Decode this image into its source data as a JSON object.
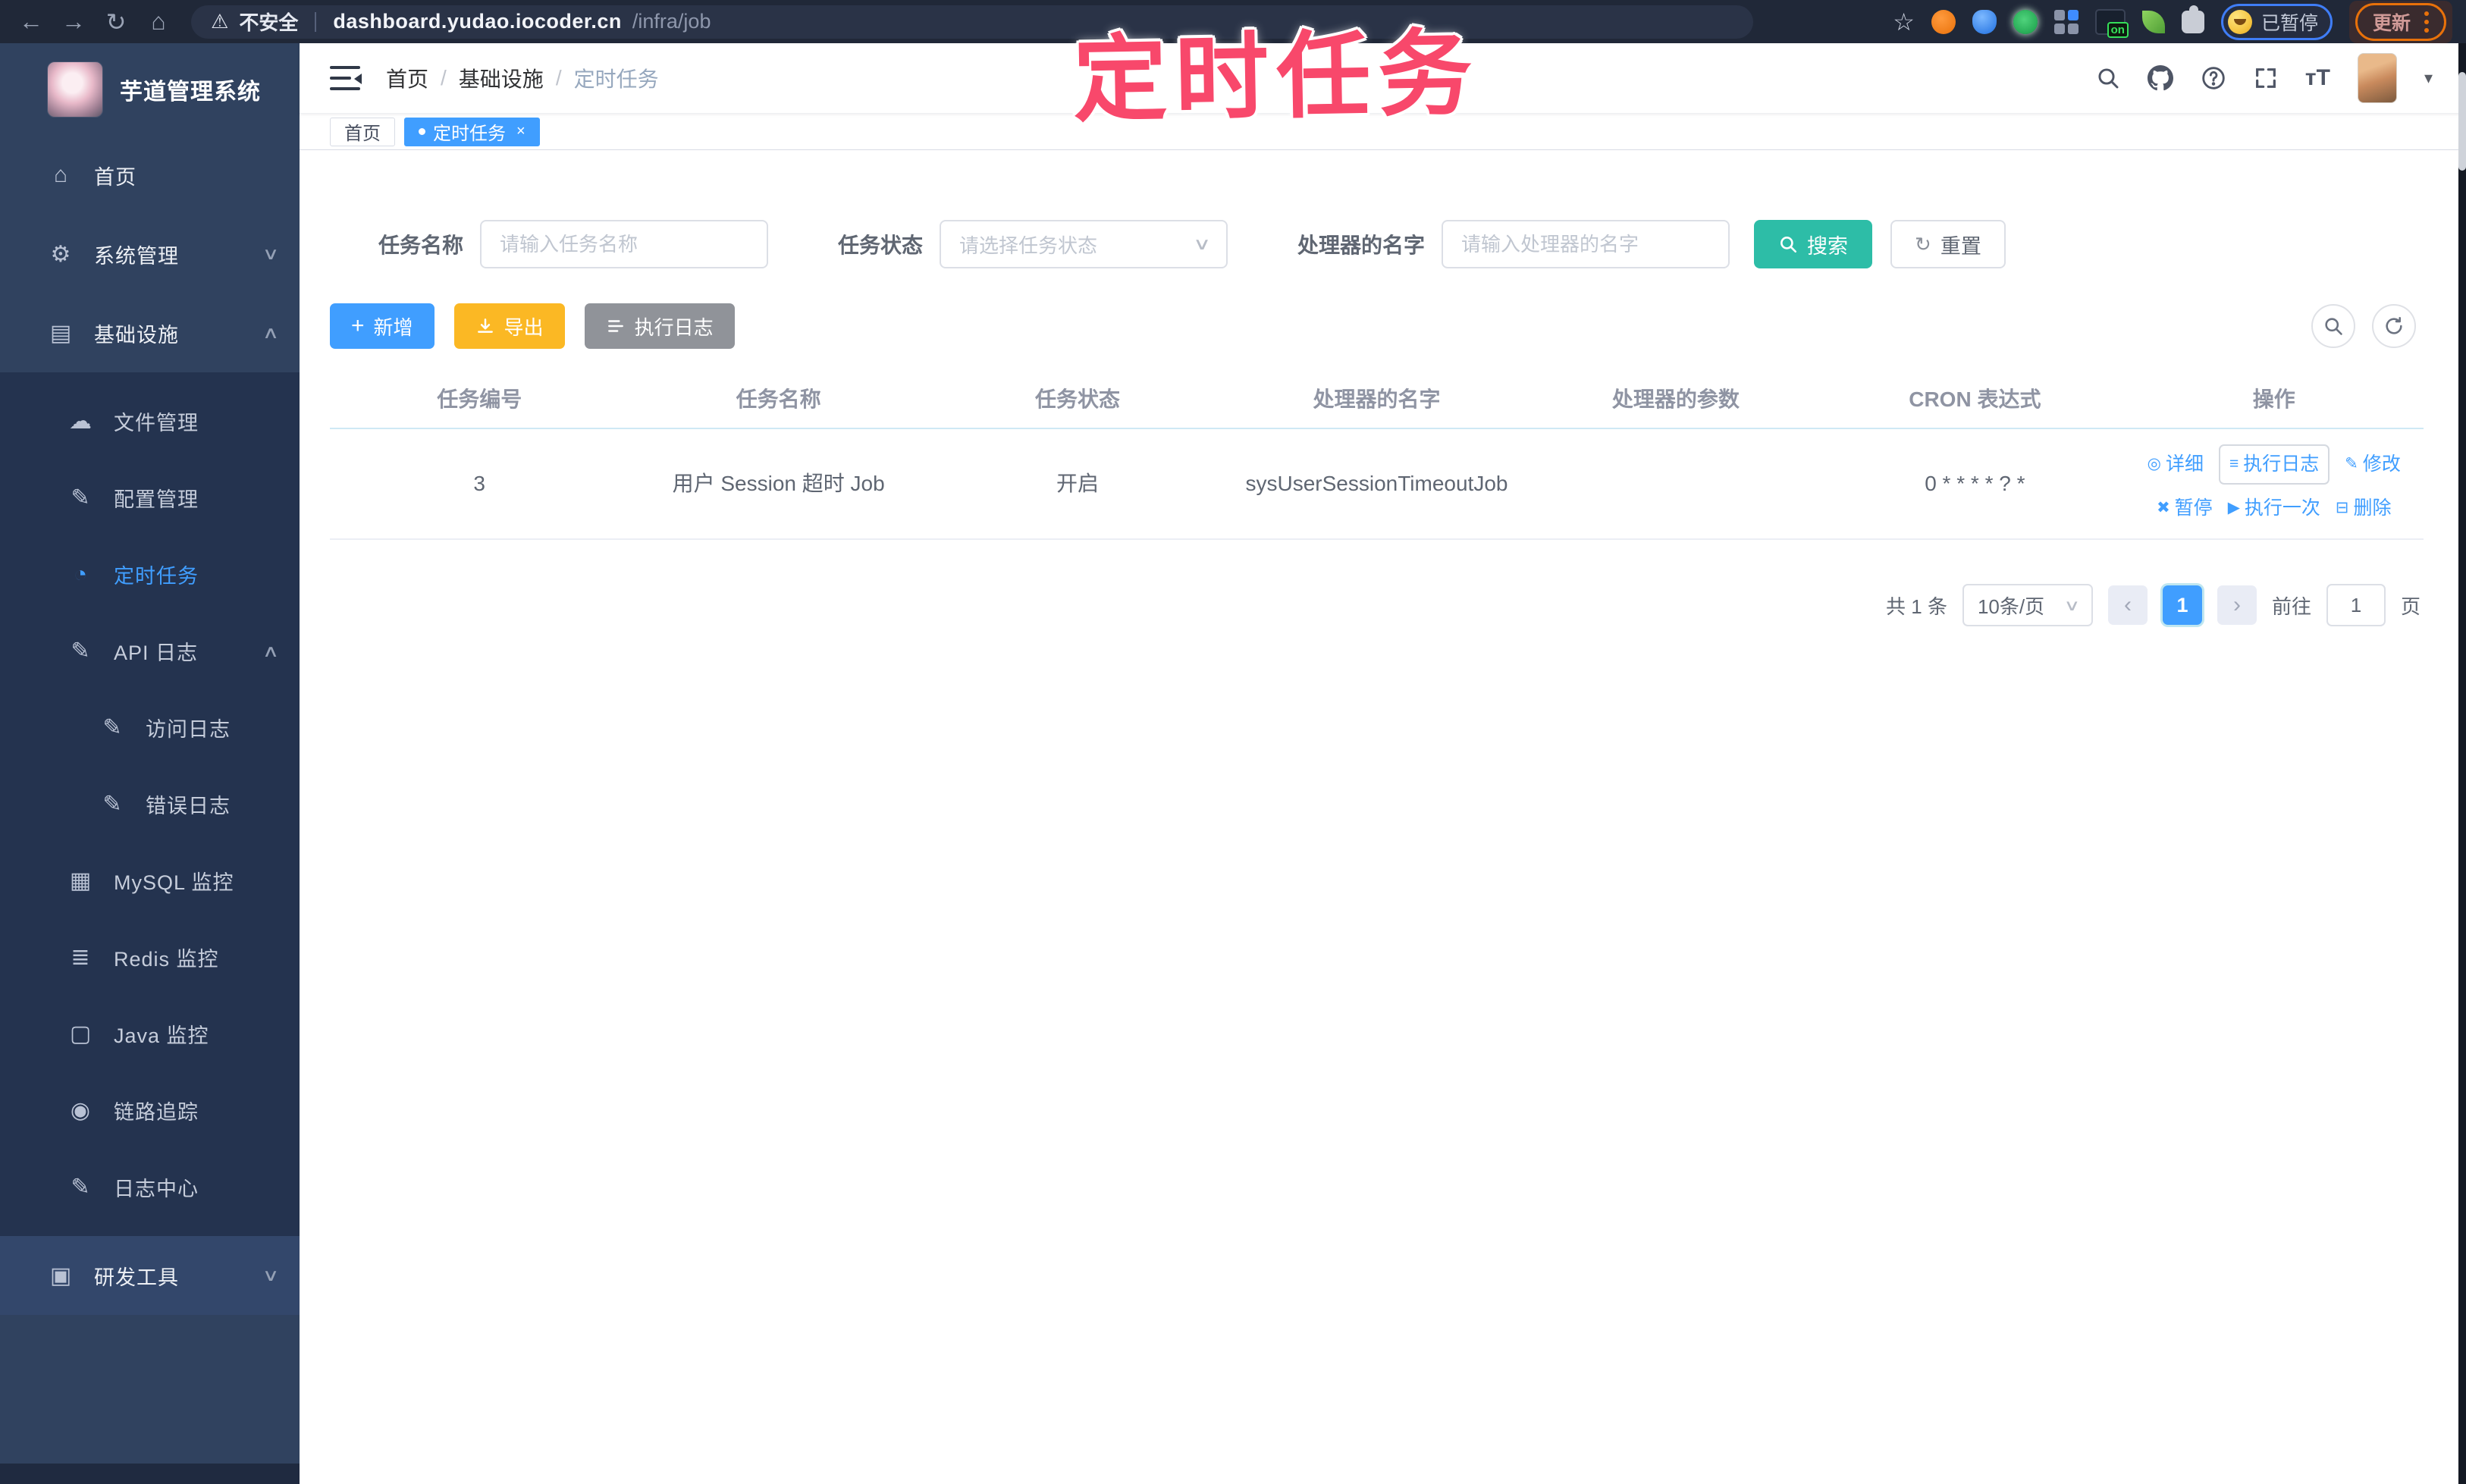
{
  "colors": {
    "primary": "#409EFF",
    "search_teal": "#2dbda7",
    "export_yellow": "#FBB824",
    "info_gray": "#909399",
    "annotation_pink": "#f8486b",
    "sidebar_bg": "#30425f",
    "submenu_bg": "#24334f"
  },
  "annotation": {
    "text": "定时任务"
  },
  "browser": {
    "security_label": "不安全",
    "url_host": "dashboard.yudao.iocoder.cn",
    "url_path": "/infra/job",
    "paused_label": "已暂停",
    "update_label": "更新",
    "on_badge": "on"
  },
  "sidebar": {
    "title": "芋道管理系统",
    "items": [
      {
        "label": "首页"
      },
      {
        "label": "系统管理"
      },
      {
        "label": "基础设施"
      },
      {
        "label": "文件管理"
      },
      {
        "label": "配置管理"
      },
      {
        "label": "定时任务"
      },
      {
        "label": "API 日志"
      },
      {
        "label": "访问日志"
      },
      {
        "label": "错误日志"
      },
      {
        "label": "MySQL 监控"
      },
      {
        "label": "Redis 监控"
      },
      {
        "label": "Java 监控"
      },
      {
        "label": "链路追踪"
      },
      {
        "label": "日志中心"
      },
      {
        "label": "研发工具"
      }
    ]
  },
  "header": {
    "breadcrumb": {
      "home": "首页",
      "section": "基础设施",
      "current": "定时任务"
    }
  },
  "tags": {
    "home": "首页",
    "current": "定时任务",
    "close": "×"
  },
  "filters": {
    "name_label": "任务名称",
    "name_placeholder": "请输入任务名称",
    "status_label": "任务状态",
    "status_placeholder": "请选择任务状态",
    "handler_label": "处理器的名字",
    "handler_placeholder": "请输入处理器的名字",
    "search_label": "搜索",
    "reset_label": "重置"
  },
  "toolbar": {
    "add_label": "新增",
    "export_label": "导出",
    "exec_log_label": "执行日志"
  },
  "table": {
    "headers": [
      "任务编号",
      "任务名称",
      "任务状态",
      "处理器的名字",
      "处理器的参数",
      "CRON 表达式",
      "操作"
    ],
    "row": {
      "id": "3",
      "name": "用户 Session 超时 Job",
      "status": "开启",
      "handler_name": "sysUserSessionTimeoutJob",
      "handler_param": "",
      "cron": "0 * * * * ? *"
    },
    "actions": {
      "detail": "详细",
      "exec_log": "执行日志",
      "edit": "修改",
      "pause": "暂停",
      "run_once": "执行一次",
      "delete": "删除"
    }
  },
  "pagination": {
    "total": "共 1 条",
    "page_size": "10条/页",
    "current_page": "1",
    "goto_label": "前往",
    "goto_value": "1",
    "page_unit": "页"
  }
}
